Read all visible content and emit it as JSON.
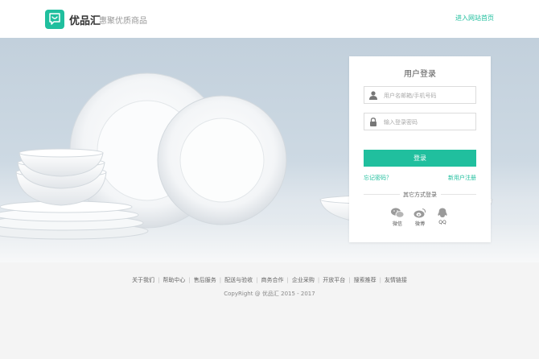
{
  "header": {
    "brand_name": "优品汇",
    "slogan": "惠聚优质商品",
    "home_link": "进入网站首页"
  },
  "colors": {
    "accent": "#20bf9e"
  },
  "login": {
    "title": "用户登录",
    "username_placeholder": "用户名邮箱/手机号码",
    "password_placeholder": "输入登录密码",
    "submit_label": "登录",
    "forgot_label": "忘记密码？",
    "register_label": "新用户注册",
    "other_methods_title": "其它方式登录",
    "social": [
      {
        "label": "微信",
        "icon": "wechat-icon"
      },
      {
        "label": "微博",
        "icon": "weibo-icon"
      },
      {
        "label": "QQ",
        "icon": "qq-icon"
      }
    ]
  },
  "footer": {
    "links": [
      "关于我们",
      "帮助中心",
      "售后服务",
      "配送与验收",
      "商务合作",
      "企业采购",
      "开放平台",
      "搜索推荐",
      "友情链接"
    ],
    "copyright": "CopyRight @ 优品汇 2015 - 2017"
  }
}
